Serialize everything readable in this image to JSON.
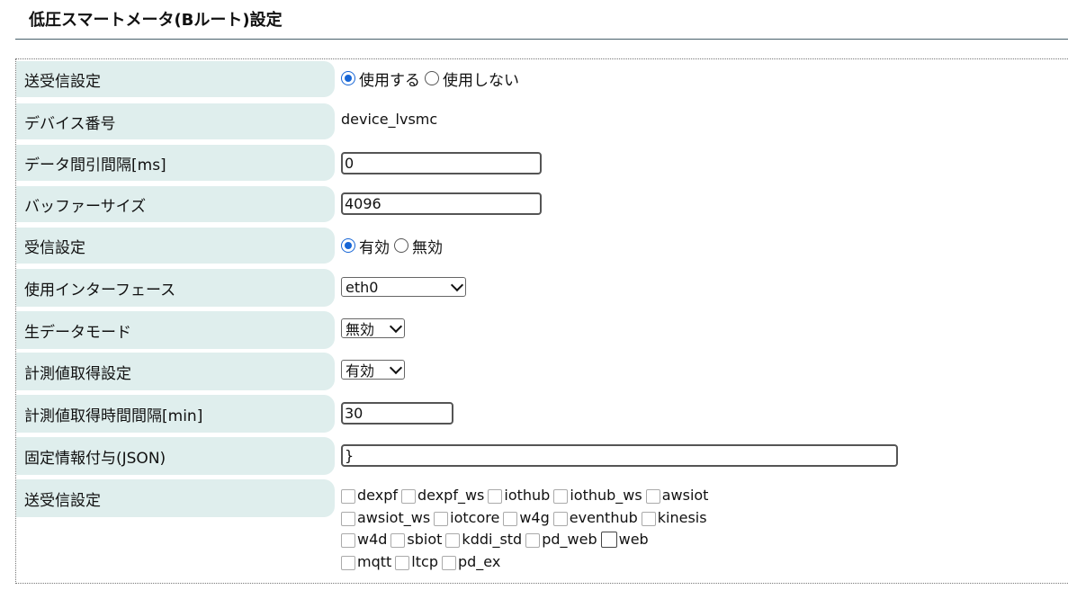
{
  "page_title": "低圧スマートメータ(Bルート)設定",
  "rows": {
    "send_recv": {
      "label": "送受信設定",
      "opt1": "使用する",
      "opt2": "使用しない"
    },
    "device_no": {
      "label": "デバイス番号",
      "value": "device_lvsmc"
    },
    "thin_interval": {
      "label": "データ間引間隔[ms]",
      "value": "0"
    },
    "buffer_size": {
      "label": "バッファーサイズ",
      "value": "4096"
    },
    "recv": {
      "label": "受信設定",
      "opt1": "有効",
      "opt2": "無効"
    },
    "interface": {
      "label": "使用インターフェース",
      "value": "eth0"
    },
    "raw_mode": {
      "label": "生データモード",
      "value": "無効"
    },
    "measure": {
      "label": "計測値取得設定",
      "value": "有効"
    },
    "measure_interval": {
      "label": "計測値取得時間間隔[min]",
      "value": "30"
    },
    "fixed_info": {
      "label": "固定情報付与(JSON)",
      "value": "}"
    },
    "send_targets": {
      "label": "送受信設定",
      "items": [
        "dexpf",
        "dexpf_ws",
        "iothub",
        "iothub_ws",
        "awsiot",
        "awsiot_ws",
        "iotcore",
        "w4g",
        "eventhub",
        "kinesis",
        "w4d",
        "sbiot",
        "kddi_std",
        "pd_web",
        "web",
        "mqtt",
        "ltcp",
        "pd_ex"
      ]
    }
  },
  "colors": {
    "label_bg": "#dfeeed",
    "radio_accent": "#1766d6"
  }
}
